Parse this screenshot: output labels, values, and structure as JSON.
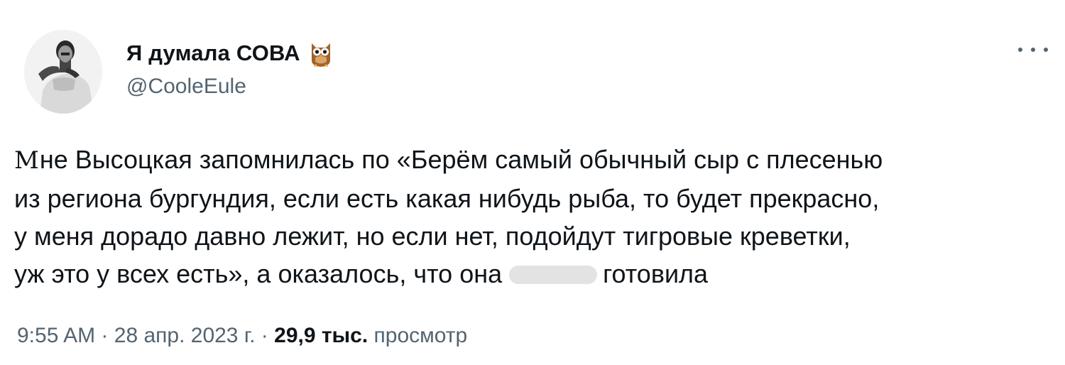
{
  "author": {
    "display_name": "Я думала СОВА",
    "emoji": "owl-icon",
    "handle": "@CooleEule"
  },
  "tweet": {
    "first_letter": "М",
    "lines": [
      "не Высоцкая запомнилась по «Берём самый обычный сыр с плесенью",
      "из региона бургундия, если есть какая нибудь рыба, то будет прекрасно,",
      "у меня дорадо давно лежит, но если нет, подойдут тигровые креветки,",
      "уж это у всех есть», а оказалось, что она"
    ],
    "line4_tail": "готовила"
  },
  "meta": {
    "time": "9:55 AM",
    "separator": "·",
    "date": "28 апр. 2023 г.",
    "views_count": "29,9 тыс.",
    "views_label": "просмотр"
  },
  "colors": {
    "text": "#0f1419",
    "secondary": "#536471"
  }
}
